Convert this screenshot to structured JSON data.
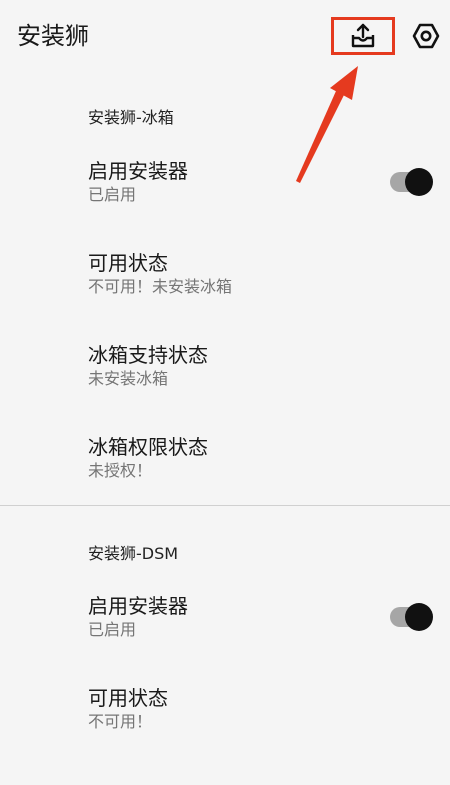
{
  "app": {
    "title": "安装狮"
  },
  "toolbar": {
    "export_icon": "export-upload-icon",
    "settings_icon": "settings-hexagon-icon",
    "highlight_color": "#e53a1f"
  },
  "sections": [
    {
      "header": "安装狮-冰箱",
      "items": [
        {
          "title": "启用安装器",
          "subtitle": "已启用",
          "toggle": true,
          "toggle_on": true
        },
        {
          "title": "可用状态",
          "subtitle": "不可用！未安装冰箱"
        },
        {
          "title": "冰箱支持状态",
          "subtitle": "未安装冰箱"
        },
        {
          "title": "冰箱权限状态",
          "subtitle": "未授权！"
        }
      ]
    },
    {
      "header": "安装狮-DSM",
      "items": [
        {
          "title": "启用安装器",
          "subtitle": "已启用",
          "toggle": true,
          "toggle_on": true
        },
        {
          "title": "可用状态",
          "subtitle": "不可用！"
        }
      ]
    }
  ]
}
